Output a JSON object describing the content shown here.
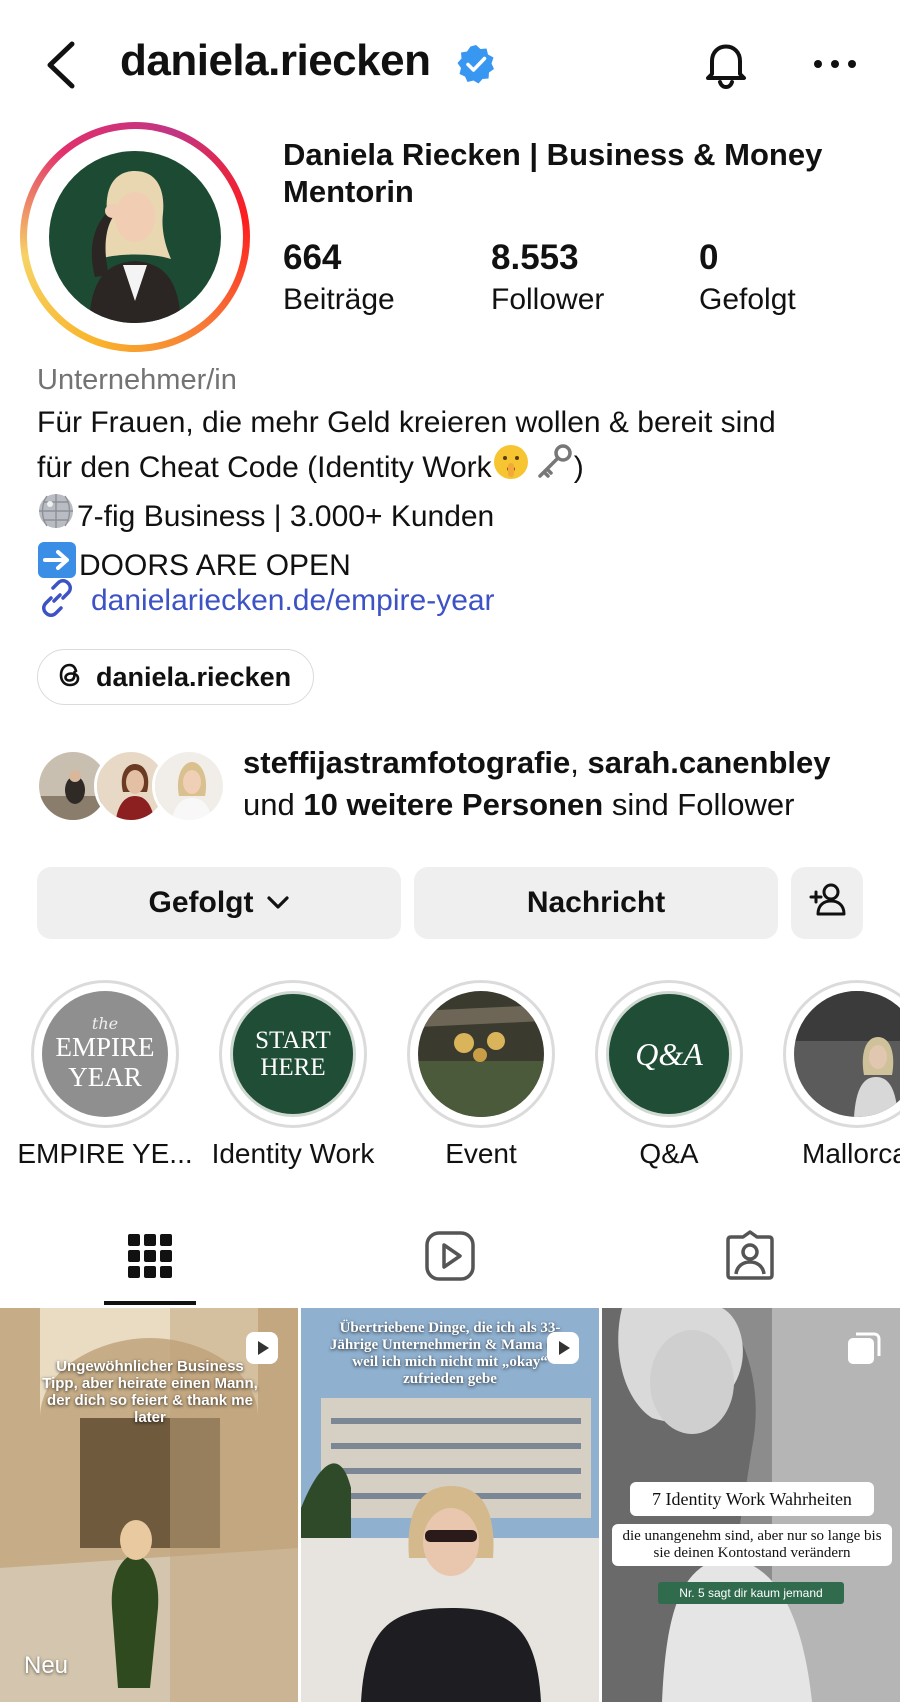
{
  "header": {
    "username": "daniela.riecken"
  },
  "profile": {
    "full_name": "Daniela Riecken | Business & Money Mentorin",
    "stats": [
      {
        "value": "664",
        "label": "Beiträge"
      },
      {
        "value": "8.553",
        "label": "Follower"
      },
      {
        "value": "0",
        "label": "Gefolgt"
      }
    ],
    "category": "Unternehmer/in",
    "bio": {
      "line1": "Für Frauen, die mehr Geld kreieren wollen & bereit sind",
      "line2": "für den Cheat Code (Identity Work",
      "line2_end": ")",
      "line3": "7-fig Business | 3.000+ Kunden",
      "line4": "DOORS ARE OPEN"
    },
    "link": "danielariecken.de/empire-year",
    "threads_handle": "daniela.riecken"
  },
  "followed_by": {
    "name1": "steffijastramfotografie",
    "separator": ",",
    "name2": "sarah.canenbley",
    "prefix": "und",
    "others": "10 weitere Personen",
    "suffix": "sind Follower"
  },
  "actions": {
    "following_label": "Gefolgt",
    "message_label": "Nachricht"
  },
  "highlights": [
    {
      "label": "EMPIRE YE...",
      "cover_text_small": "the",
      "cover_text": "EMPIRE YEAR"
    },
    {
      "label": "Identity Work",
      "cover_text": "START HERE"
    },
    {
      "label": "Event"
    },
    {
      "label": "Q&A",
      "cover_text": "Q&A"
    },
    {
      "label": "Mallorca"
    }
  ],
  "posts": [
    {
      "overlay_text": "Ungewöhnlicher Business Tipp, aber heirate einen Mann, der dich so feiert & thank me later",
      "badge": "Neu"
    },
    {
      "overlay_text": "Übertriebene Dinge, die ich als 33-Jährige Unternehmerin & Mama tue, weil ich mich nicht mit „okay“ zufrieden gebe"
    },
    {
      "title": "7 Identity Work Wahrheiten",
      "subtitle": "die unangenehm sind, aber nur so lange bis sie deinen Kontostand verändern",
      "tag": "Nr. 5 sagt dir kaum jemand"
    }
  ],
  "colors": {
    "link": "#3d52c4",
    "verified": "#3897f0",
    "button_bg": "#efefef",
    "highlight_green": "#1f4d35",
    "category_gray": "#737373"
  }
}
